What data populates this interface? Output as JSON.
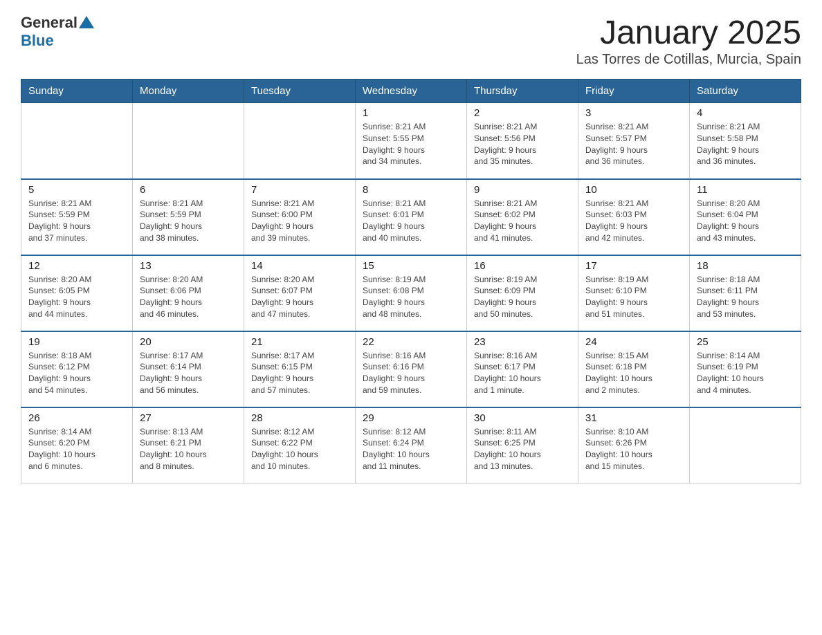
{
  "logo": {
    "general": "General",
    "arrow": "▲",
    "blue": "Blue"
  },
  "title": "January 2025",
  "subtitle": "Las Torres de Cotillas, Murcia, Spain",
  "weekdays": [
    "Sunday",
    "Monday",
    "Tuesday",
    "Wednesday",
    "Thursday",
    "Friday",
    "Saturday"
  ],
  "weeks": [
    [
      {
        "day": "",
        "info": ""
      },
      {
        "day": "",
        "info": ""
      },
      {
        "day": "",
        "info": ""
      },
      {
        "day": "1",
        "info": "Sunrise: 8:21 AM\nSunset: 5:55 PM\nDaylight: 9 hours\nand 34 minutes."
      },
      {
        "day": "2",
        "info": "Sunrise: 8:21 AM\nSunset: 5:56 PM\nDaylight: 9 hours\nand 35 minutes."
      },
      {
        "day": "3",
        "info": "Sunrise: 8:21 AM\nSunset: 5:57 PM\nDaylight: 9 hours\nand 36 minutes."
      },
      {
        "day": "4",
        "info": "Sunrise: 8:21 AM\nSunset: 5:58 PM\nDaylight: 9 hours\nand 36 minutes."
      }
    ],
    [
      {
        "day": "5",
        "info": "Sunrise: 8:21 AM\nSunset: 5:59 PM\nDaylight: 9 hours\nand 37 minutes."
      },
      {
        "day": "6",
        "info": "Sunrise: 8:21 AM\nSunset: 5:59 PM\nDaylight: 9 hours\nand 38 minutes."
      },
      {
        "day": "7",
        "info": "Sunrise: 8:21 AM\nSunset: 6:00 PM\nDaylight: 9 hours\nand 39 minutes."
      },
      {
        "day": "8",
        "info": "Sunrise: 8:21 AM\nSunset: 6:01 PM\nDaylight: 9 hours\nand 40 minutes."
      },
      {
        "day": "9",
        "info": "Sunrise: 8:21 AM\nSunset: 6:02 PM\nDaylight: 9 hours\nand 41 minutes."
      },
      {
        "day": "10",
        "info": "Sunrise: 8:21 AM\nSunset: 6:03 PM\nDaylight: 9 hours\nand 42 minutes."
      },
      {
        "day": "11",
        "info": "Sunrise: 8:20 AM\nSunset: 6:04 PM\nDaylight: 9 hours\nand 43 minutes."
      }
    ],
    [
      {
        "day": "12",
        "info": "Sunrise: 8:20 AM\nSunset: 6:05 PM\nDaylight: 9 hours\nand 44 minutes."
      },
      {
        "day": "13",
        "info": "Sunrise: 8:20 AM\nSunset: 6:06 PM\nDaylight: 9 hours\nand 46 minutes."
      },
      {
        "day": "14",
        "info": "Sunrise: 8:20 AM\nSunset: 6:07 PM\nDaylight: 9 hours\nand 47 minutes."
      },
      {
        "day": "15",
        "info": "Sunrise: 8:19 AM\nSunset: 6:08 PM\nDaylight: 9 hours\nand 48 minutes."
      },
      {
        "day": "16",
        "info": "Sunrise: 8:19 AM\nSunset: 6:09 PM\nDaylight: 9 hours\nand 50 minutes."
      },
      {
        "day": "17",
        "info": "Sunrise: 8:19 AM\nSunset: 6:10 PM\nDaylight: 9 hours\nand 51 minutes."
      },
      {
        "day": "18",
        "info": "Sunrise: 8:18 AM\nSunset: 6:11 PM\nDaylight: 9 hours\nand 53 minutes."
      }
    ],
    [
      {
        "day": "19",
        "info": "Sunrise: 8:18 AM\nSunset: 6:12 PM\nDaylight: 9 hours\nand 54 minutes."
      },
      {
        "day": "20",
        "info": "Sunrise: 8:17 AM\nSunset: 6:14 PM\nDaylight: 9 hours\nand 56 minutes."
      },
      {
        "day": "21",
        "info": "Sunrise: 8:17 AM\nSunset: 6:15 PM\nDaylight: 9 hours\nand 57 minutes."
      },
      {
        "day": "22",
        "info": "Sunrise: 8:16 AM\nSunset: 6:16 PM\nDaylight: 9 hours\nand 59 minutes."
      },
      {
        "day": "23",
        "info": "Sunrise: 8:16 AM\nSunset: 6:17 PM\nDaylight: 10 hours\nand 1 minute."
      },
      {
        "day": "24",
        "info": "Sunrise: 8:15 AM\nSunset: 6:18 PM\nDaylight: 10 hours\nand 2 minutes."
      },
      {
        "day": "25",
        "info": "Sunrise: 8:14 AM\nSunset: 6:19 PM\nDaylight: 10 hours\nand 4 minutes."
      }
    ],
    [
      {
        "day": "26",
        "info": "Sunrise: 8:14 AM\nSunset: 6:20 PM\nDaylight: 10 hours\nand 6 minutes."
      },
      {
        "day": "27",
        "info": "Sunrise: 8:13 AM\nSunset: 6:21 PM\nDaylight: 10 hours\nand 8 minutes."
      },
      {
        "day": "28",
        "info": "Sunrise: 8:12 AM\nSunset: 6:22 PM\nDaylight: 10 hours\nand 10 minutes."
      },
      {
        "day": "29",
        "info": "Sunrise: 8:12 AM\nSunset: 6:24 PM\nDaylight: 10 hours\nand 11 minutes."
      },
      {
        "day": "30",
        "info": "Sunrise: 8:11 AM\nSunset: 6:25 PM\nDaylight: 10 hours\nand 13 minutes."
      },
      {
        "day": "31",
        "info": "Sunrise: 8:10 AM\nSunset: 6:26 PM\nDaylight: 10 hours\nand 15 minutes."
      },
      {
        "day": "",
        "info": ""
      }
    ]
  ]
}
